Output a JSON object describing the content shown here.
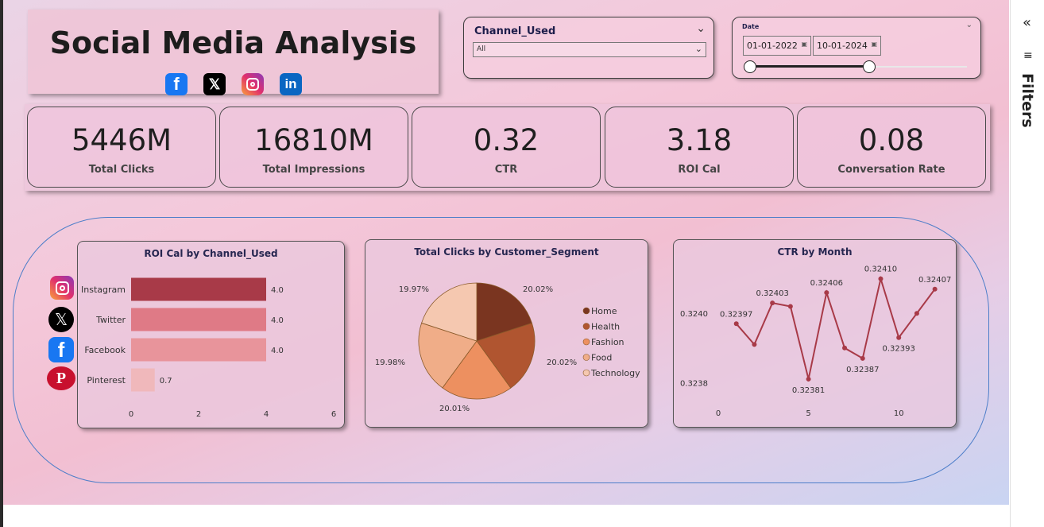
{
  "header": {
    "title": "Social Media Analysis",
    "social_icons": [
      "facebook-icon",
      "x-icon",
      "instagram-icon",
      "linkedin-icon"
    ]
  },
  "filters": {
    "channel": {
      "label": "Channel_Used",
      "selected": "All"
    },
    "date": {
      "label": "Date",
      "start": "01-01-2022",
      "end": "10-01-2024",
      "range_start_fraction": 0.0,
      "range_end_fraction": 0.55
    }
  },
  "kpis": [
    {
      "value": "5446M",
      "label": "Total Clicks"
    },
    {
      "value": "16810M",
      "label": "Total Impressions"
    },
    {
      "value": "0.32",
      "label": "CTR"
    },
    {
      "value": "3.18",
      "label": "ROI Cal"
    },
    {
      "value": "0.08",
      "label": "Conversation Rate"
    }
  ],
  "filters_pane": {
    "label": "Filters",
    "collapse_icon": "«"
  },
  "colors": {
    "bar_instagram": "#a83a48",
    "bar_twitter": "#df7a86",
    "bar_facebook": "#e8949b",
    "bar_pinterest": "#f0b8bb",
    "line": "#a83a48",
    "pie": [
      "#7a3520",
      "#b05530",
      "#ed9060",
      "#f0ad88",
      "#f5c8b0"
    ]
  },
  "chart_data": [
    {
      "type": "bar",
      "orientation": "horizontal",
      "title": "ROI Cal by Channel_Used",
      "categories": [
        "Instagram",
        "Twitter",
        "Facebook",
        "Pinterest"
      ],
      "values": [
        4.0,
        4.0,
        4.0,
        0.7
      ],
      "data_labels": [
        "4.0",
        "4.0",
        "4.0",
        "0.7"
      ],
      "xlim": [
        0,
        6
      ],
      "xticks": [
        "0",
        "2",
        "4",
        "6"
      ]
    },
    {
      "type": "pie",
      "title": "Total Clicks by Customer_Segment",
      "categories": [
        "Home",
        "Health",
        "Fashion",
        "Food",
        "Technology"
      ],
      "values": [
        20.02,
        20.02,
        20.01,
        19.98,
        19.97
      ],
      "data_labels": [
        "20.02%",
        "20.02%",
        "20.01%",
        "19.98%",
        "19.97%"
      ],
      "legend": "right"
    },
    {
      "type": "line",
      "title": "CTR by Month",
      "x": [
        1,
        2,
        3,
        4,
        5,
        6,
        7,
        8,
        9,
        10,
        11,
        12
      ],
      "y": [
        0.32397,
        0.32391,
        0.32403,
        0.32402,
        0.32381,
        0.32406,
        0.3239,
        0.32387,
        0.3241,
        0.32393,
        0.324,
        0.32407
      ],
      "data_labels": [
        "0.32397",
        "",
        "0.32403",
        "",
        "0.32381",
        "0.32406",
        "",
        "0.32387",
        "0.32410",
        "0.32393",
        "",
        "0.32407"
      ],
      "xticks": [
        "0",
        "5",
        "10"
      ],
      "yticks": [
        "0.3240",
        "0.3238"
      ],
      "xlim": [
        0,
        12.5
      ],
      "ylim": [
        0.32378,
        0.32412
      ]
    }
  ]
}
